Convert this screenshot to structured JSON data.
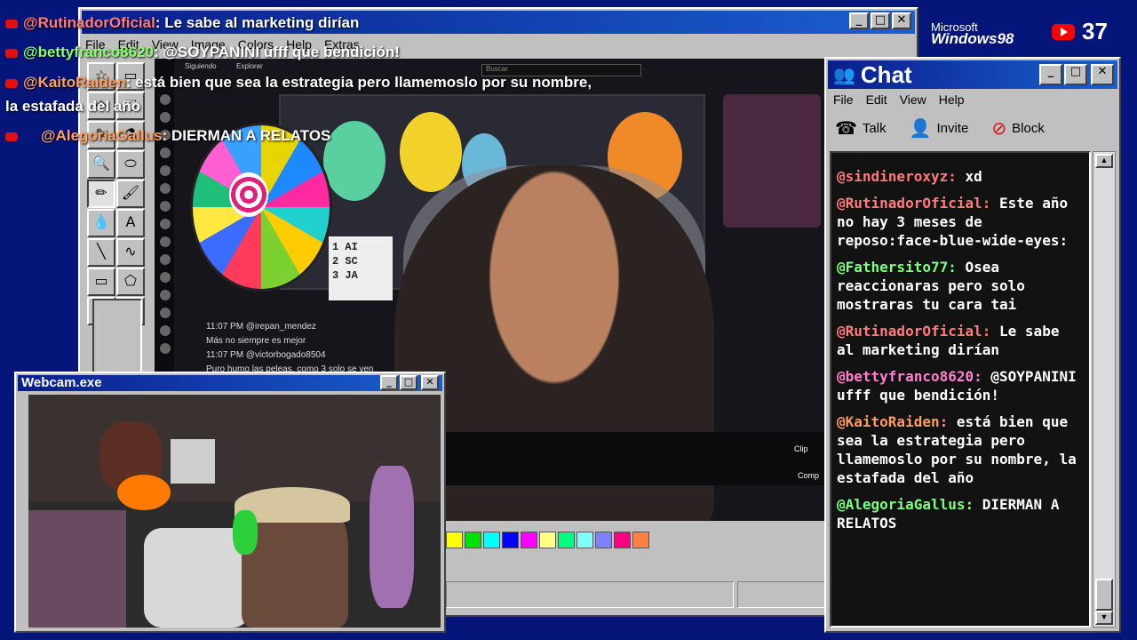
{
  "overlay_chat": [
    {
      "user": "@RutinadorOficial",
      "text": ": Le sabe al marketing dirían"
    },
    {
      "user": "@bettyfranco8620",
      "text": ": @SOYPANINI ufff que bendición!"
    },
    {
      "user": "@KaitoRaiden",
      "text": ": está bien que sea la estrategia pero llamemoslo por su nombre,"
    },
    {
      "user": "",
      "text": "la estafada del año"
    },
    {
      "user": "@AlegoriaGallus",
      "text": ": DIERMAN A RELATOS"
    }
  ],
  "paint": {
    "menu": [
      "File",
      "Edit",
      "View",
      "Image",
      "Colors",
      "Help",
      "Extras"
    ],
    "tools": [
      "☆",
      "▭",
      "◇",
      "⬚",
      "✎",
      "⚗",
      "🔍",
      "⬭",
      "✏",
      "🖌",
      "💧",
      "A",
      "╲",
      "∿",
      "▭",
      "⬠",
      "⬭",
      "▢"
    ],
    "palette": [
      "#ffff00",
      "#00e000",
      "#00ffff",
      "#0000ff",
      "#ff00ff",
      "#ffff80",
      "#00ff80",
      "#80ffff",
      "#8080ff",
      "#ff0080",
      "#ff8040"
    ]
  },
  "stream": {
    "nav": [
      "Siguiendo",
      "Explorar"
    ],
    "search_placeholder": "Buscar",
    "board_text": "1 AI\n2 SC\n3 JA",
    "chat_lines": [
      {
        "user": "@irepan_mendez",
        "time": "11:07 PM",
        "text": "Más no siempre es mejor"
      },
      {
        "user": "@victorbogado8504",
        "time": "11:07 PM",
        "text": "Puro humo las peleas, como 3 solo se ven"
      }
    ],
    "clip_label": "Clip",
    "comp_label": "Comp"
  },
  "brand": {
    "top": "Microsoft",
    "bottom": "Windows98"
  },
  "viewers": "37",
  "chat": {
    "title": "Chat",
    "menu": [
      "File",
      "Edit",
      "View",
      "Help"
    ],
    "toolbar": [
      {
        "label": "Talk",
        "icon": "☎"
      },
      {
        "label": "Invite",
        "icon": "👤"
      },
      {
        "label": "Block",
        "icon": "⊘"
      }
    ],
    "messages": [
      {
        "user": "@sindineroxyz:",
        "text": " xd"
      },
      {
        "user": "@RutinadorOficial:",
        "text": " Este año no hay 3 meses de reposo:face-blue-wide-eyes:"
      },
      {
        "user": "@Fathersito77:",
        "text": " Osea reaccionaras pero solo mostraras tu cara tai"
      },
      {
        "user": "@RutinadorOficial:",
        "text": " Le sabe al marketing dirían"
      },
      {
        "user": "@bettyfranco8620:",
        "text": " @SOYPANINI ufff que bendición!"
      },
      {
        "user": "@KaitoRaiden:",
        "text": " está bien que sea la estrategia pero llamemoslo por su nombre, la estafada del año"
      },
      {
        "user": "@AlegoriaGallus:",
        "text": " DIERMAN A RELATOS"
      }
    ]
  },
  "webcam": {
    "title": "Webcam.exe"
  }
}
